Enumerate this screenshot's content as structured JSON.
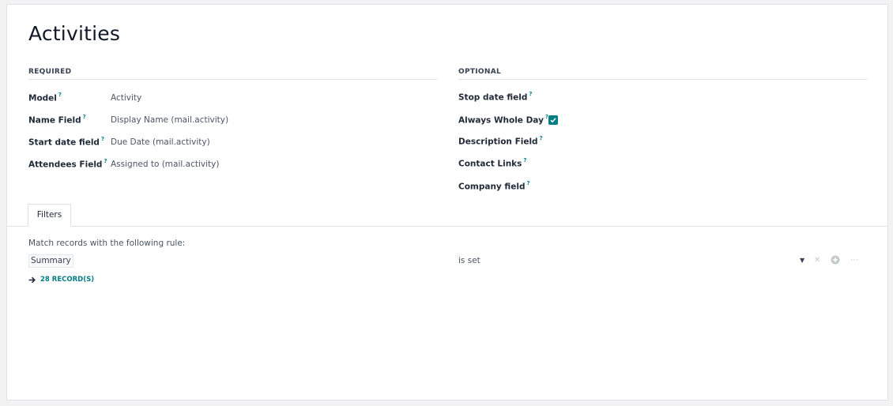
{
  "page_title": "Activities",
  "groups": {
    "required": {
      "heading": "REQUIRED",
      "fields": [
        {
          "label": "Model",
          "help": "?",
          "value": "Activity"
        },
        {
          "label": "Name Field",
          "help": "?",
          "value": "Display Name (mail.activity)"
        },
        {
          "label": "Start date field",
          "help": "?",
          "value": "Due Date (mail.activity)"
        },
        {
          "label": "Attendees Field",
          "help": "?",
          "value": "Assigned to (mail.activity)"
        }
      ]
    },
    "optional": {
      "heading": "OPTIONAL",
      "fields": [
        {
          "label": "Stop date field",
          "help": "?",
          "value": ""
        },
        {
          "label": "Always Whole Day",
          "help": "?",
          "checked": true
        },
        {
          "label": "Description Field",
          "help": "?",
          "value": ""
        },
        {
          "label": "Contact Links",
          "help": "?",
          "value": ""
        },
        {
          "label": "Company field",
          "help": "?",
          "value": ""
        }
      ]
    }
  },
  "tabs": [
    {
      "label": "Filters",
      "active": true
    }
  ],
  "filter": {
    "intro": "Match records with the following rule:",
    "rule": {
      "path": "Summary",
      "operator": "is set"
    },
    "records_link": "28 RECORD(S)"
  },
  "colors": {
    "accent": "#017e84",
    "border": "#dee2e6"
  },
  "icons": {
    "checkbox": "check-icon",
    "dropdown": "caret-down-icon",
    "remove": "close-icon",
    "add": "plus-circle-icon",
    "more": "ellipsis-icon",
    "records": "arrow-right-icon"
  }
}
